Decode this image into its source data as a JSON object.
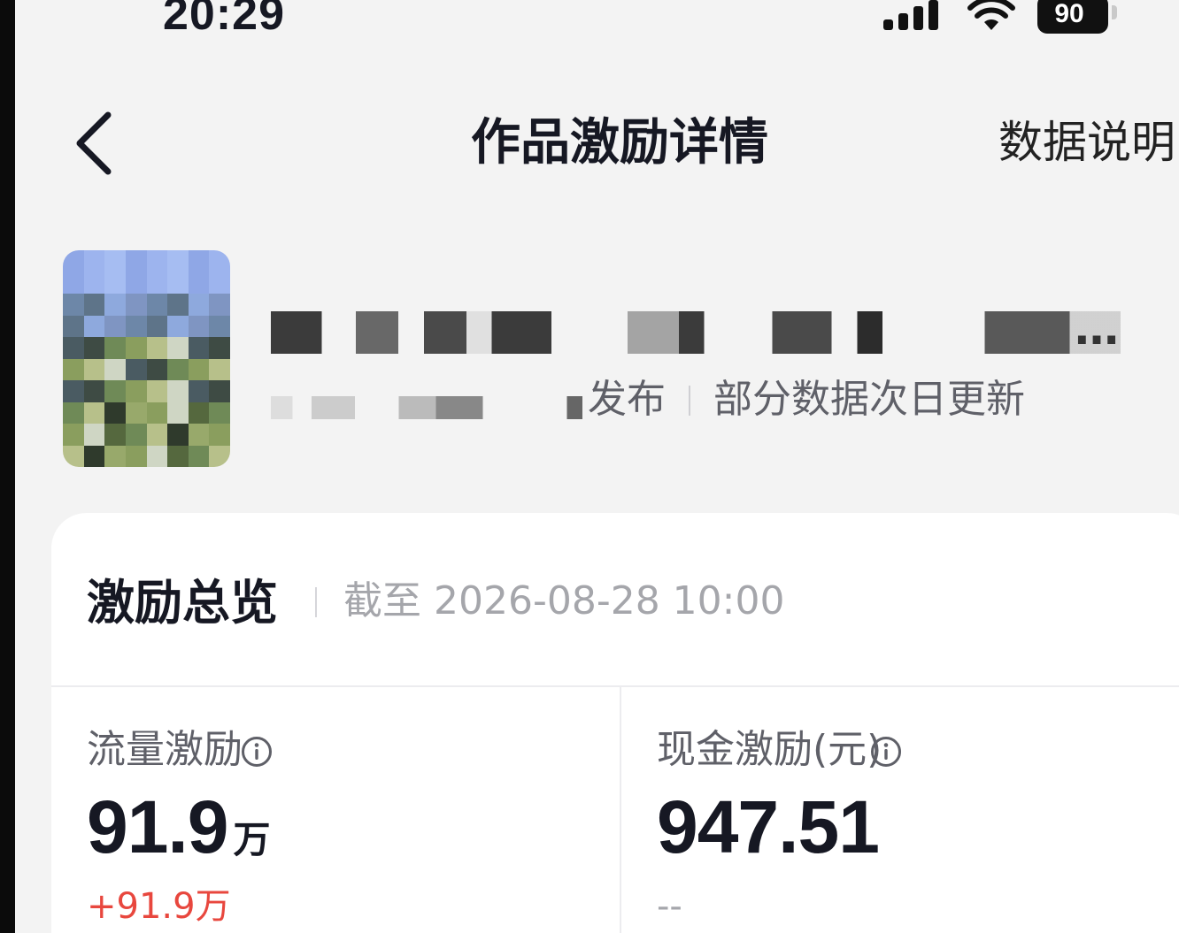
{
  "status_bar": {
    "time": "20:29",
    "battery": "90",
    "icons": [
      "signal-icon",
      "wifi-icon",
      "battery-icon"
    ]
  },
  "nav": {
    "back_icon": "chevron-left-icon",
    "title": "作品激励详情",
    "right_action": "数据说明"
  },
  "video": {
    "title_suffix": "…",
    "publish_label": "发布",
    "update_note": "部分数据次日更新"
  },
  "overview": {
    "title": "激励总览",
    "as_of": "截至 2026-08-28 10:00"
  },
  "metrics": [
    {
      "label": "流量激励",
      "value": "91.9",
      "unit": "万",
      "change": "+91.9万",
      "change_color": "#e8473e",
      "icon": "info-icon"
    },
    {
      "label": "现金激励(元)",
      "value": "947.51",
      "unit": "",
      "change": "--",
      "change_color": "#a5a6ab",
      "icon": "info-icon"
    }
  ],
  "colors": {
    "page_bg": "#f3f3f3",
    "card_bg": "#ffffff",
    "primary_text": "#161823",
    "secondary_text": "#5f6068",
    "muted_text": "#a5a6ab",
    "increase": "#e8473e"
  }
}
